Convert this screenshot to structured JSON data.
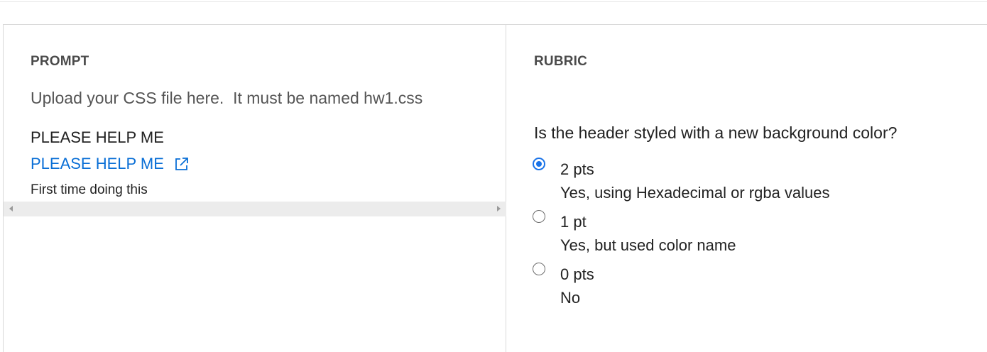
{
  "prompt": {
    "label": "PROMPT",
    "text": "Upload your CSS file here.  It must be named hw1.css",
    "heading": "PLEASE HELP ME",
    "link_text": "PLEASE HELP ME",
    "note": "First time doing this"
  },
  "rubric": {
    "label": "RUBRIC",
    "question": "Is the header styled with a new background color?",
    "options": [
      {
        "points": "2 pts",
        "description": "Yes, using Hexadecimal or rgba values",
        "selected": true
      },
      {
        "points": "1 pt",
        "description": "Yes, but used color name",
        "selected": false
      },
      {
        "points": "0 pts",
        "description": "No",
        "selected": false
      }
    ]
  },
  "icons": {
    "external_link": "external-link-icon",
    "scroll_left": "scroll-left-arrow-icon",
    "scroll_right": "scroll-right-arrow-icon"
  },
  "colors": {
    "link": "#0a6fd6",
    "radio_selected": "#1a73e8",
    "divider": "#d9d9d9"
  }
}
